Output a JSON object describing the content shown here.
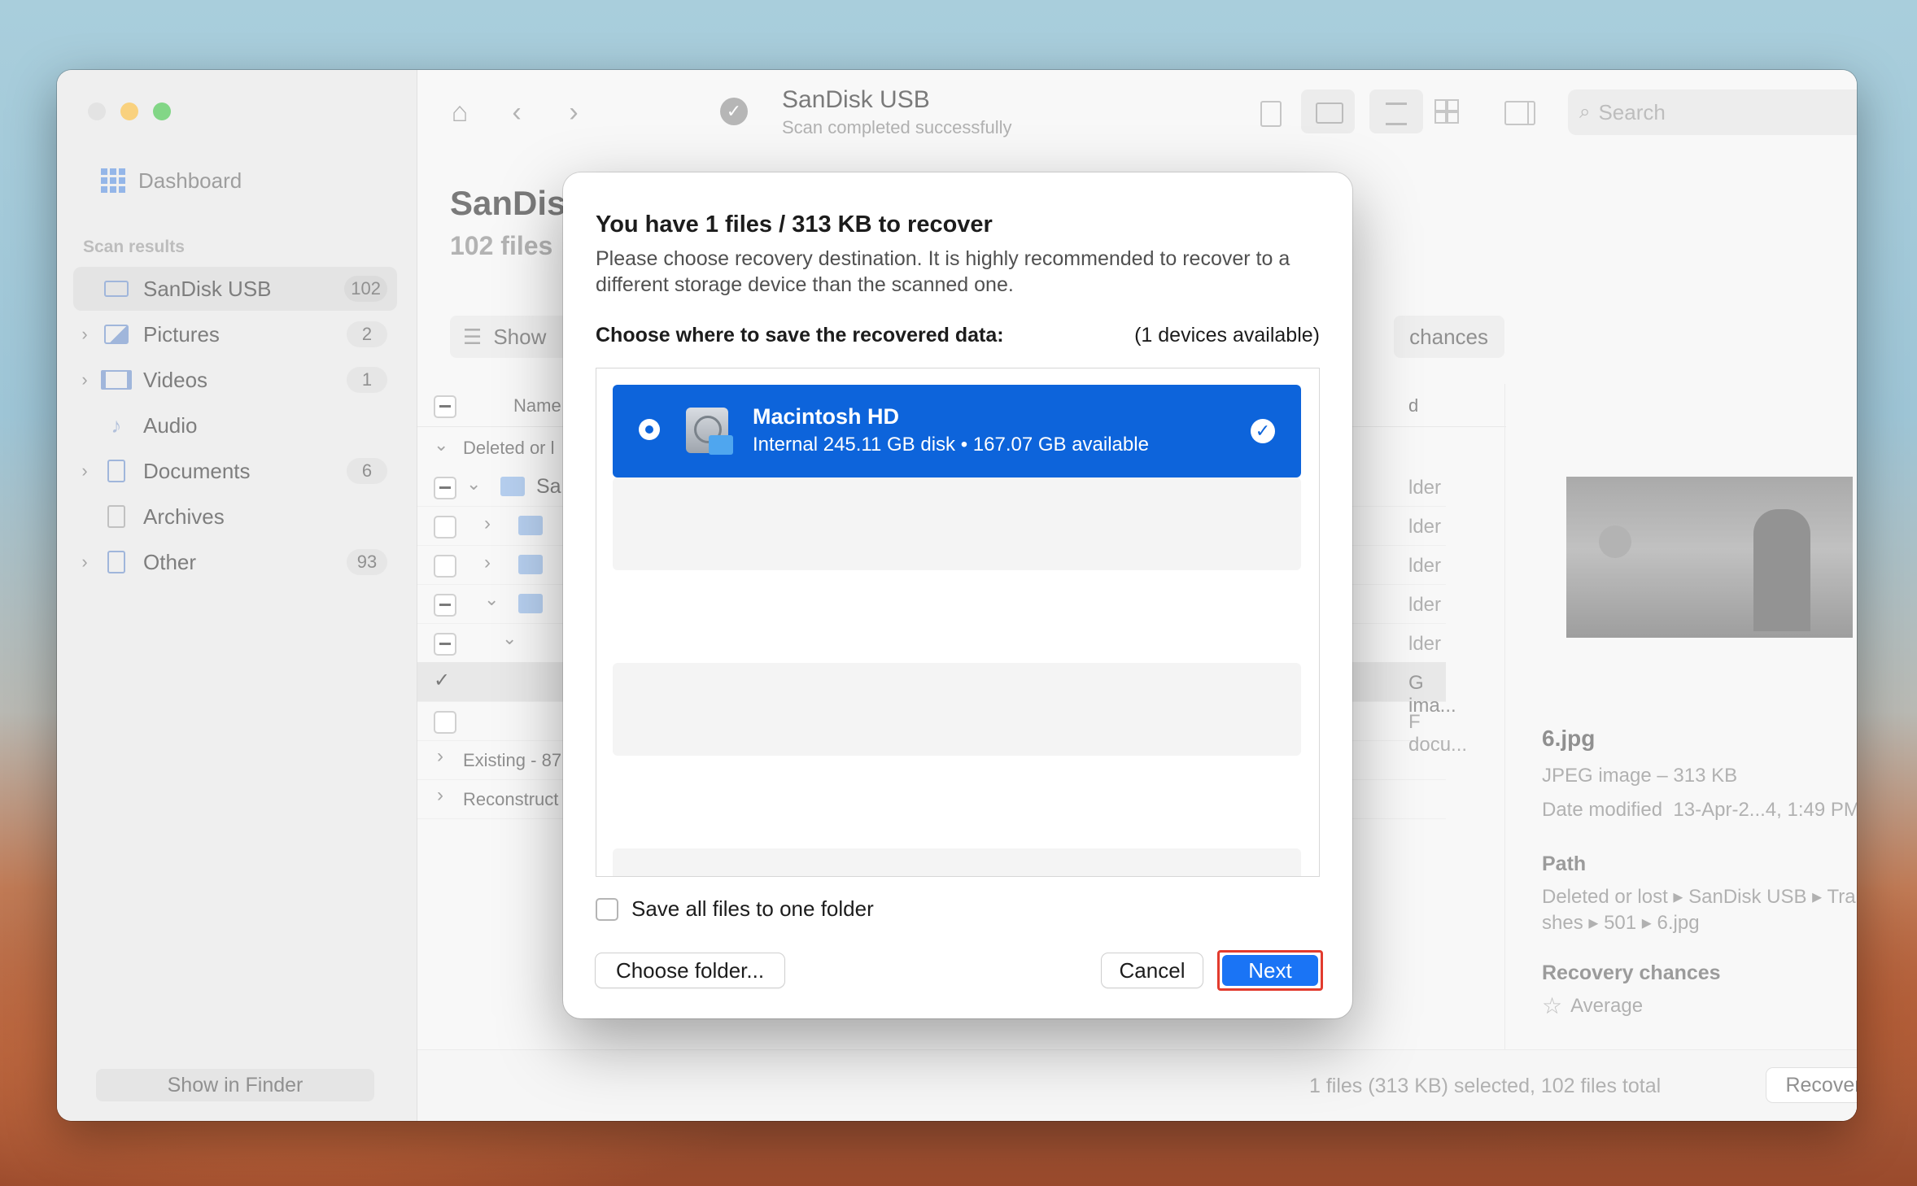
{
  "window": {
    "toolbar": {
      "title": "SanDisk USB",
      "subtitle": "Scan completed successfully",
      "search_placeholder": "Search"
    },
    "sidebar": {
      "dashboard_label": "Dashboard",
      "section_header": "Scan results",
      "items": [
        {
          "label": "SanDisk USB",
          "count": "102",
          "icon": "usb-drive-icon"
        },
        {
          "label": "Pictures",
          "count": "2",
          "icon": "image-icon"
        },
        {
          "label": "Videos",
          "count": "1",
          "icon": "film-icon"
        },
        {
          "label": "Audio",
          "count": "",
          "icon": "music-note-icon"
        },
        {
          "label": "Documents",
          "count": "6",
          "icon": "document-icon"
        },
        {
          "label": "Archives",
          "count": "",
          "icon": "archive-icon"
        },
        {
          "label": "Other",
          "count": "93",
          "icon": "other-file-icon"
        }
      ],
      "show_in_finder": "Show in Finder"
    },
    "content": {
      "heading": "SanDis",
      "subheading": "102 files",
      "show_button": "Show",
      "chances_button": "chances",
      "column_name": "Name",
      "column_kind": "d",
      "groups": {
        "deleted": "Deleted or l",
        "existing": "Existing - 87",
        "reconstructed": "Reconstruct"
      },
      "first_folder": "Sa",
      "kind_values": [
        "lder",
        "lder",
        "lder",
        "lder",
        "lder",
        "G ima...",
        "F docu..."
      ]
    },
    "preview": {
      "filename": "6.jpg",
      "type_size": "JPEG image – 313 KB",
      "date_modified": "Date modified  13-Apr-2...4, 1:49 PM",
      "path_label": "Path",
      "path_value_line1": "Deleted or lost ▸ SanDisk USB ▸ Tra",
      "path_value_line2": "shes ▸ 501 ▸ 6.jpg",
      "chances_label": "Recovery chances",
      "chances_value": "Average"
    },
    "status": {
      "text": "1 files (313 KB) selected, 102 files total",
      "recover_button": "Recover"
    }
  },
  "dialog": {
    "title": "You have 1 files / 313 KB to recover",
    "description": "Please choose recovery destination. It is highly recommended to recover to a different storage device than the scanned one.",
    "choose_label": "Choose where to save the recovered data:",
    "devices_available": "(1 devices available)",
    "device": {
      "name": "Macintosh HD",
      "details": "Internal 245.11 GB disk • 167.07 GB available"
    },
    "save_one_folder": "Save all files to one folder",
    "choose_folder_button": "Choose folder...",
    "cancel_button": "Cancel",
    "next_button": "Next",
    "accent": "#0d64db",
    "highlight": "#e23b2e"
  }
}
